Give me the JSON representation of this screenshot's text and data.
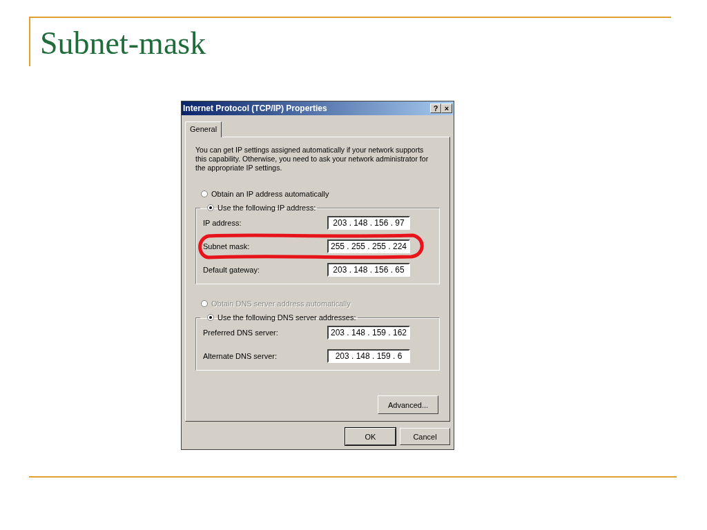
{
  "slide": {
    "title": "Subnet-mask"
  },
  "dialog": {
    "title": "Internet Protocol (TCP/IP) Properties",
    "title_buttons": [
      "?",
      "×"
    ],
    "tabs": [
      {
        "label": "General",
        "selected": true
      }
    ],
    "description": "You can get IP settings assigned automatically if your network supports this capability. Otherwise, you need to ask your network administrator for the appropriate IP settings.",
    "ip_options": [
      {
        "label": "Obtain an IP address automatically",
        "selected": false,
        "disabled": false
      },
      {
        "label": "Use the following IP address:",
        "selected": true,
        "disabled": false
      }
    ],
    "ip_fields": [
      {
        "label": "IP address:",
        "value": "203 . 148 . 156 . 97",
        "highlighted": false
      },
      {
        "label": "Subnet mask:",
        "value": "255 . 255 . 255 . 224",
        "highlighted": true
      },
      {
        "label": "Default gateway:",
        "value": "203 . 148 . 156 . 65",
        "highlighted": false
      }
    ],
    "dns_options": [
      {
        "label": "Obtain DNS server address automatically",
        "selected": false,
        "disabled": true
      },
      {
        "label": "Use the following DNS server addresses:",
        "selected": true,
        "disabled": false
      }
    ],
    "dns_fields": [
      {
        "label": "Preferred DNS server:",
        "value": "203 . 148 . 159 . 162",
        "highlighted": false
      },
      {
        "label": "Alternate DNS server:",
        "value": "203 . 148 . 159 . 6",
        "highlighted": false
      }
    ],
    "advanced_button": "Advanced...",
    "buttons": [
      {
        "label": "OK",
        "default": true
      },
      {
        "label": "Cancel",
        "default": false
      }
    ]
  }
}
